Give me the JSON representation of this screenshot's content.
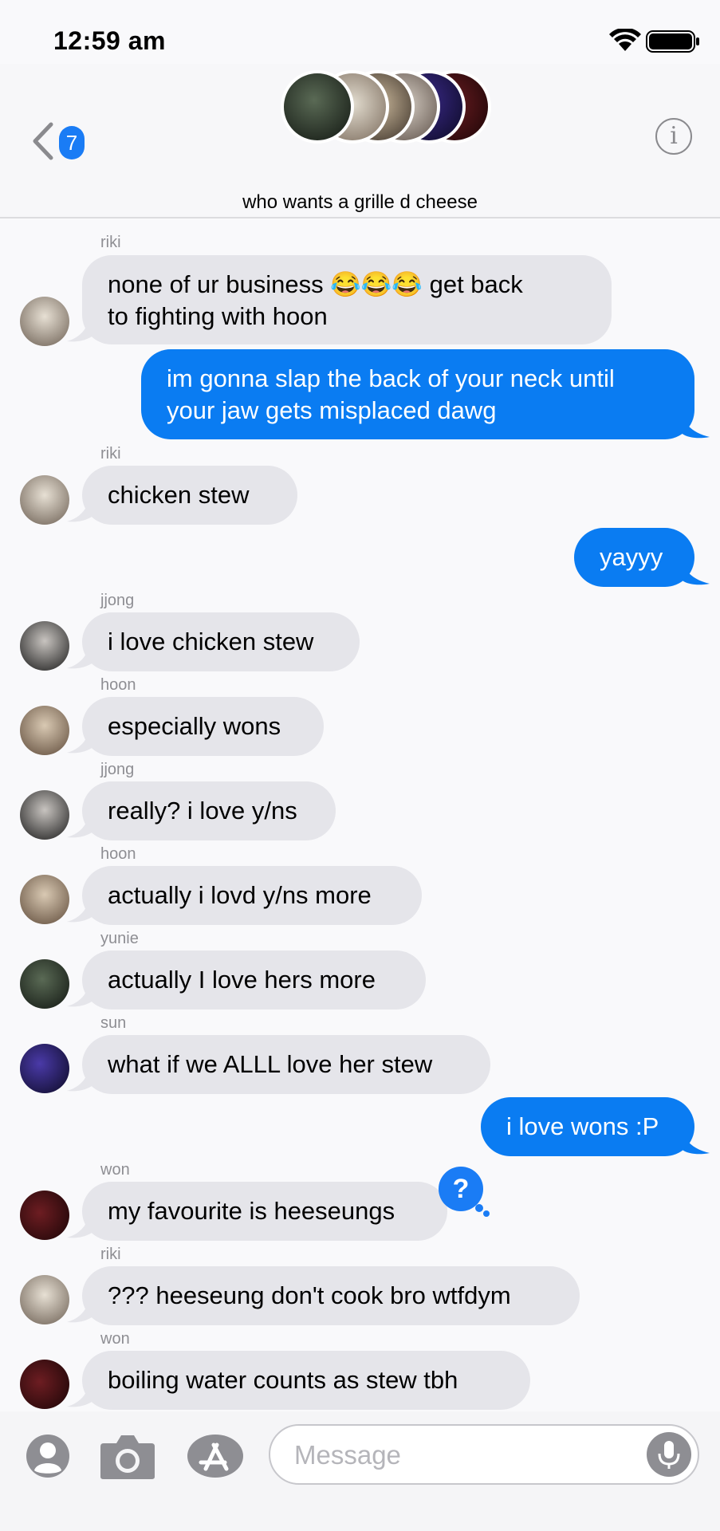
{
  "status_bar": {
    "time": "12:59 am"
  },
  "header": {
    "back_badge": "7",
    "group_name": "who wants a grille d cheese",
    "info_label": "i"
  },
  "messages": [
    {
      "sender": "riki",
      "text_lines": [
        "none of ur business 😂😂😂 get back",
        "to fighting with hoon"
      ],
      "direction": "incoming"
    },
    {
      "text_lines": [
        "im gonna slap the back of your neck until",
        "your jaw gets misplaced dawg"
      ],
      "direction": "outgoing"
    },
    {
      "sender": "riki",
      "text": "chicken stew",
      "direction": "incoming"
    },
    {
      "text": "yayyy",
      "direction": "outgoing"
    },
    {
      "sender": "jjong",
      "text": "i love chicken stew",
      "direction": "incoming"
    },
    {
      "sender": "hoon",
      "text": "especially wons",
      "direction": "incoming"
    },
    {
      "sender": "jjong",
      "text": "really? i love y/ns",
      "direction": "incoming"
    },
    {
      "sender": "hoon",
      "text": "actually i lovd y/ns more",
      "direction": "incoming"
    },
    {
      "sender": "yunie",
      "text": "actually I love hers more",
      "direction": "incoming"
    },
    {
      "sender": "sun",
      "text": "what if we ALLL love her stew",
      "direction": "incoming"
    },
    {
      "text": "i love wons :P",
      "direction": "outgoing"
    },
    {
      "sender": "won",
      "text": "my favourite is heeseungs",
      "direction": "incoming",
      "tapback": "?"
    },
    {
      "sender": "riki",
      "text": "??? heeseung don't cook bro wtfdym",
      "direction": "incoming"
    },
    {
      "sender": "won",
      "text": "boiling water counts as stew tbh",
      "direction": "incoming"
    }
  ],
  "input_bar": {
    "placeholder": "Message"
  },
  "colors": {
    "outgoing_bubble": "#0a7cf2",
    "incoming_bubble": "#e5e5ea",
    "accent": "#1a7cf5",
    "sender_label": "#8e8e93"
  },
  "icons": [
    "wifi-icon",
    "battery-icon",
    "back-chevron-icon",
    "info-icon",
    "contact-icon",
    "camera-icon",
    "app-store-icon",
    "mic-icon",
    "tapback-question-icon"
  ]
}
